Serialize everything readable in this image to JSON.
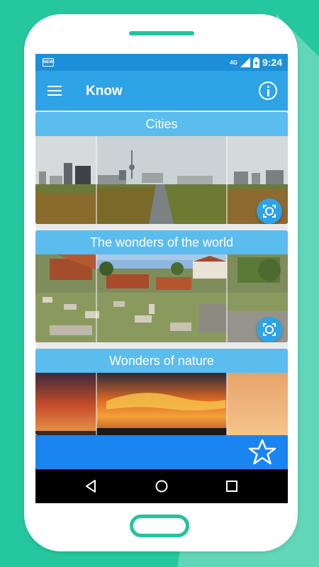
{
  "status_bar": {
    "left_badge": "NEW",
    "network": "4G",
    "time": "9:24"
  },
  "app_bar": {
    "title": "Know"
  },
  "cards": [
    {
      "title": "Cities"
    },
    {
      "title": "The wonders of the world"
    },
    {
      "title": "Wonders of nature"
    }
  ],
  "colors": {
    "background": "#25c79f",
    "app_bar": "#2ea3e6",
    "status_bar": "#1d8fd8",
    "card_title": "#5bbcee",
    "bottom_bar": "#1a84f0"
  },
  "icons": {
    "menu": "menu-icon",
    "info": "info-icon",
    "focus": "focus-icon",
    "star": "star-icon",
    "nav_back": "back-icon",
    "nav_home": "home-icon",
    "nav_recents": "recents-icon"
  }
}
